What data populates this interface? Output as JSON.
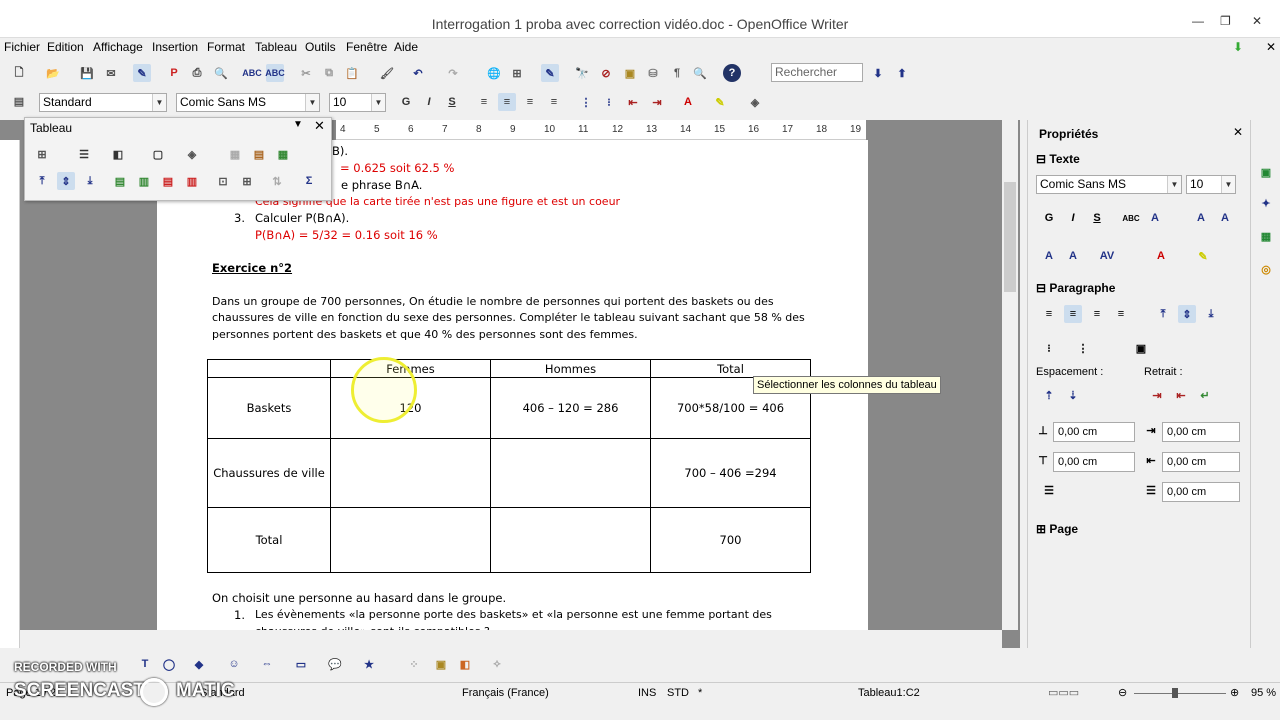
{
  "window": {
    "title": "Interrogation  1 proba avec correction vidéo.doc - OpenOffice Writer"
  },
  "menu": [
    "Fichier",
    "Edition",
    "Affichage",
    "Insertion",
    "Format",
    "Tableau",
    "Outils",
    "Fenêtre",
    "Aide"
  ],
  "toolbar": {
    "search_placeholder": "Rechercher",
    "style": "Standard",
    "font": "Comic Sans MS",
    "size": "10"
  },
  "tableau_panel": {
    "title": "Tableau"
  },
  "ruler_marks": [
    "4",
    "5",
    "6",
    "7",
    "8",
    "9",
    "10",
    "11",
    "12",
    "13",
    "14",
    "15",
    "16",
    "17",
    "18",
    "19"
  ],
  "doc": {
    "line1": "B).",
    "line2": "= 0.625 soit 62.5 %",
    "line3": "e phrase B∩A.",
    "line4": "Cela signifie que la carte tirée n'est pas une figure et est un coeur",
    "item3_num": "3.",
    "item3": "Calculer P(B∩A).",
    "item3_ans": "P(B∩A) = 5/32 = 0.16 soit 16 %",
    "exercise_title": "Exercice n°2",
    "para1": "Dans un groupe de 700 personnes, On étudie le nombre de personnes qui portent des baskets ou des",
    "para2": "chaussures de ville en fonction du sexe des personnes. Compléter le tableau suivant sachant que 58 % des",
    "para3": "personnes portent des baskets et que 40 % des personnes sont des femmes.",
    "table": {
      "header": [
        "",
        "Femmes",
        "Hommes",
        "Total"
      ],
      "rows": [
        [
          "Baskets",
          "120",
          "406 – 120 = 286",
          "700*58/100 = 406"
        ],
        [
          "Chaussures de ville",
          "",
          "",
          "700 – 406 =294"
        ],
        [
          "Total",
          "",
          "",
          "700"
        ]
      ]
    },
    "after1": "On choisit une personne au hasard dans le groupe.",
    "after2_num": "1.",
    "after2": "Les évènements «la personne porte des baskets» et «la personne est une femme portant des",
    "after3": "chaussures de ville» sont-ils compatibles ?"
  },
  "tooltip": "Sélectionner les colonnes du tableau",
  "sidebar": {
    "title": "Propriétés",
    "texte": "Texte",
    "font": "Comic Sans MS",
    "size": "10",
    "paragraphe": "Paragraphe",
    "espacement": "Espacement :",
    "retrait": "Retrait :",
    "spin1": "0,00 cm",
    "spin2": "0,00 cm",
    "spin3": "0,00 cm",
    "spin4": "0,00 cm",
    "spin5": "0,00 cm",
    "page": "Page"
  },
  "status": {
    "page": "Page 1 / 2",
    "words": "Standard",
    "lang": "Français (France)",
    "ins": "INS",
    "std": "STD",
    "star": "*",
    "cell": "Tableau1:C2",
    "zoom": "95 %"
  },
  "watermark": {
    "line1": "RECORDED WITH",
    "line2": "SCREENCAST",
    "line3": "MATIC"
  }
}
